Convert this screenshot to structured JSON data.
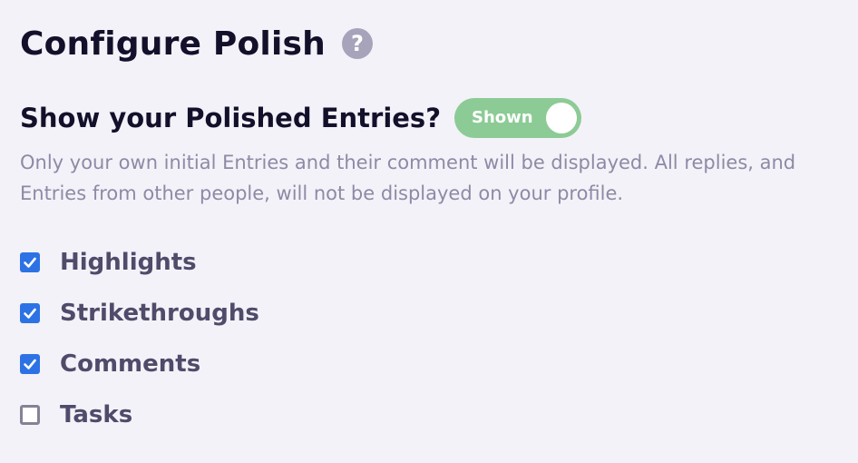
{
  "header": {
    "title": "Configure Polish",
    "help_icon": "question-icon",
    "help_glyph": "?"
  },
  "polished_entries": {
    "title": "Show your Polished Entries?",
    "toggle_label": "Shown",
    "toggle_on": true,
    "toggle_color": "#8ccb95",
    "description": "Only your own initial Entries and their comment will be displayed. All replies, and Entries from other people, will not be displayed on your profile."
  },
  "options": [
    {
      "label": "Highlights",
      "checked": true
    },
    {
      "label": "Strikethroughs",
      "checked": true
    },
    {
      "label": "Comments",
      "checked": true
    },
    {
      "label": "Tasks",
      "checked": false
    }
  ],
  "colors": {
    "checkbox_checked": "#2d72e5",
    "background": "#f3f2f8",
    "muted_text": "#8d8aa6"
  }
}
